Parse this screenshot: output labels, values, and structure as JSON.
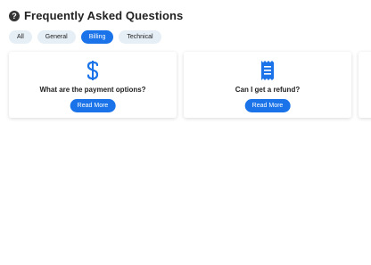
{
  "header": {
    "icon": "question-circle-icon",
    "title": "Frequently Asked Questions"
  },
  "filters": {
    "active": "Billing",
    "items": [
      {
        "label": "All"
      },
      {
        "label": "General"
      },
      {
        "label": "Billing"
      },
      {
        "label": "Technical"
      }
    ]
  },
  "cards": [
    {
      "icon": "dollar-sign-icon",
      "question": "What are the payment options?",
      "button_label": "Read More"
    },
    {
      "icon": "receipt-icon",
      "question": "Can I get a refund?",
      "button_label": "Read More"
    }
  ],
  "colors": {
    "accent": "#1a73e8",
    "chip_bg": "#e6eef6",
    "text": "#222222"
  }
}
